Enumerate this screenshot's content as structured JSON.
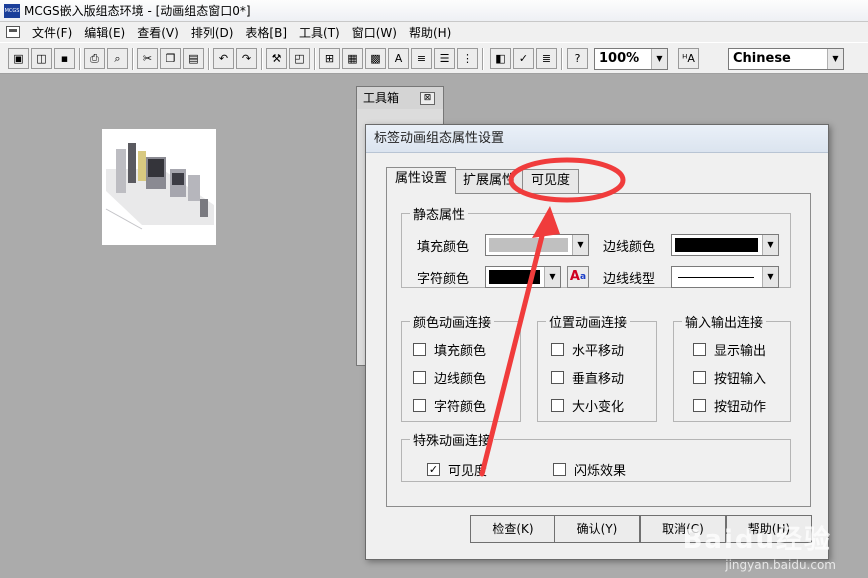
{
  "window": {
    "title": "MCGS嵌入版组态环境 - [动画组态窗口0*]",
    "app_icon_text": "MCGS"
  },
  "menu": [
    "文件(F)",
    "编辑(E)",
    "查看(V)",
    "排列(D)",
    "表格[B]",
    "工具(T)",
    "窗口(W)",
    "帮助(H)"
  ],
  "toolbar": {
    "zoom": "100%",
    "language": "Chinese"
  },
  "toolbox": {
    "title": "工具箱",
    "close": "⊠"
  },
  "dialog": {
    "title": "标签动画组态属性设置",
    "tabs": [
      "属性设置",
      "扩展属性",
      "可见度"
    ],
    "static": {
      "legend": "静态属性",
      "fill_label": "填充颜色",
      "font_label": "字符颜色",
      "border_color_label": "边线颜色",
      "border_style_label": "边线线型",
      "fill_color": "#c0c0c0",
      "font_color": "#000000",
      "border_color": "#000000"
    },
    "color_anim": {
      "legend": "颜色动画连接",
      "items": [
        "填充颜色",
        "边线颜色",
        "字符颜色"
      ]
    },
    "position_anim": {
      "legend": "位置动画连接",
      "items": [
        "水平移动",
        "垂直移动",
        "大小变化"
      ]
    },
    "io_conn": {
      "legend": "输入输出连接",
      "items": [
        "显示输出",
        "按钮输入",
        "按钮动作"
      ]
    },
    "special": {
      "legend": "特殊动画连接",
      "visible_label": "可见度",
      "visible_checked": "✓",
      "blink_label": "闪烁效果"
    },
    "buttons": [
      "检查(K)",
      "确认(Y)",
      "取消(C)",
      "帮助(H)"
    ]
  },
  "watermark": {
    "main": "Baidu经验",
    "sub": "jingyan.baidu.com"
  },
  "annotation_color": "#f03c3c"
}
